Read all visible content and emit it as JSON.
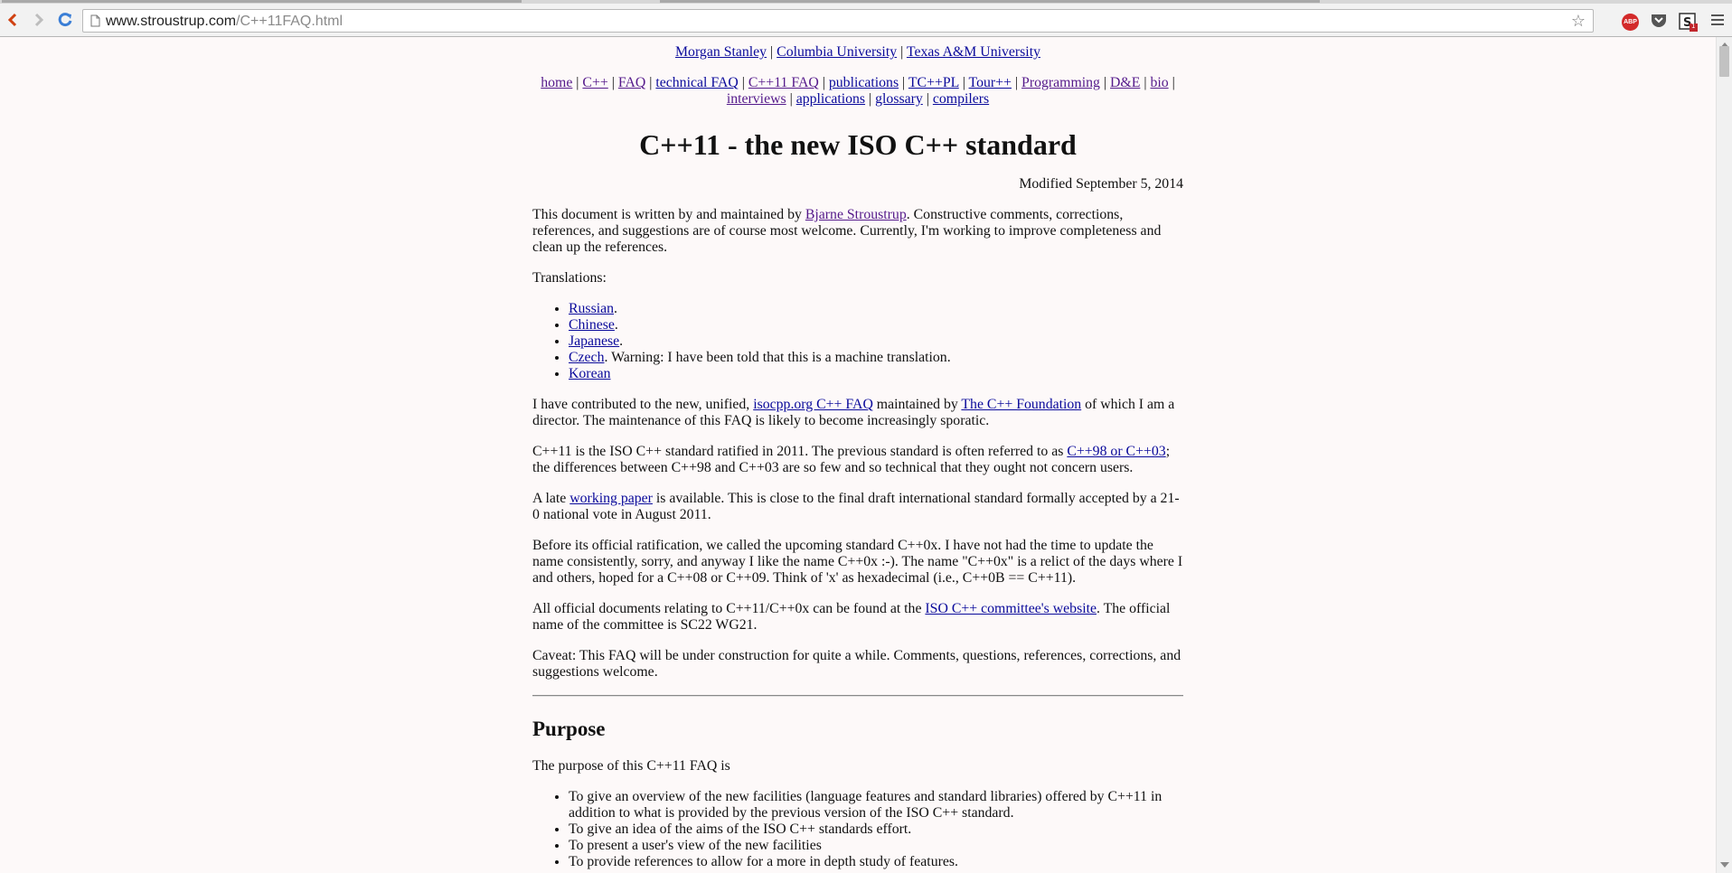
{
  "browser": {
    "url_host": "www.stroustrup.com",
    "url_path": "/C++11FAQ.html",
    "extensions": [
      "adblock-plus-icon",
      "pocket-icon",
      "s-extension-icon"
    ],
    "abp_label": "ABP",
    "ext_badge": "1"
  },
  "page": {
    "affiliations": [
      "Morgan Stanley",
      "Columbia University",
      "Texas A&M University"
    ],
    "nav_links": [
      {
        "label": "home"
      },
      {
        "label": "C++"
      },
      {
        "label": "FAQ"
      },
      {
        "label": "technical FAQ"
      },
      {
        "label": "C++11 FAQ"
      },
      {
        "label": "publications"
      },
      {
        "label": "TC++PL"
      },
      {
        "label": "Tour++"
      },
      {
        "label": "Programming"
      },
      {
        "label": "D&E"
      },
      {
        "label": "bio"
      },
      {
        "label": "interviews"
      },
      {
        "label": "applications"
      },
      {
        "label": "glossary"
      },
      {
        "label": "compilers"
      }
    ],
    "separator": "|",
    "title": "C++11 - the new ISO C++ standard",
    "modified": "Modified September 5, 2014",
    "intro": {
      "before": "This document is written by and maintained by ",
      "link": "Bjarne Stroustrup",
      "after": ". Constructive comments, corrections, references, and suggestions are of course most welcome. Currently, I'm working to improve completeness and clean up the references."
    },
    "translations_label": "Translations:",
    "translations": [
      {
        "link": "Russian",
        "suffix": "."
      },
      {
        "link": "Chinese",
        "suffix": "."
      },
      {
        "link": "Japanese",
        "suffix": "."
      },
      {
        "link": "Czech",
        "suffix": ". Warning: I have been told that this is a machine translation."
      },
      {
        "link": "Korean",
        "suffix": ""
      }
    ],
    "isocpp": {
      "before": "I have contributed to the new, unified, ",
      "link1": "isocpp.org C++ FAQ",
      "middle": " maintained by ",
      "link2": "The C++ Foundation",
      "after": " of which I am a director. The maintenance of this FAQ is likely to become increasingly sporatic."
    },
    "ratified": {
      "before": "C++11 is the ISO C++ standard ratified in 2011. The previous standard is often referred to as ",
      "link": "C++98 or C++03",
      "after": "; the differences between C++98 and C++03 are so few and so technical that they ought not concern users."
    },
    "working_paper": {
      "before": "A late ",
      "link": "working paper",
      "after": " is available. This is close to the final draft international standard formally accepted by a 21-0 national vote in August 2011."
    },
    "cpp0x": "Before its official ratification, we called the upcoming standard C++0x. I have not had the time to update the name consistently, sorry, and anyway I like the name C++0x :-). The name \"C++0x\" is a relict of the days where I and others, hoped for a C++08 or C++09. Think of 'x' as hexadecimal (i.e., C++0B == C++11).",
    "official_docs": {
      "before": "All official documents relating to C++11/C++0x can be found at the ",
      "link": "ISO C++ committee's website",
      "after": ". The official name of the committee is SC22 WG21."
    },
    "caveat": "Caveat: This FAQ will be under construction for quite a while. Comments, questions, references, corrections, and suggestions welcome.",
    "purpose_heading": "Purpose",
    "purpose_intro": "The purpose of this C++11 FAQ is",
    "purpose_items": [
      "To give an overview of the new facilities (language features and standard libraries) offered by C++11 in addition to what is provided by the previous version of the ISO C++ standard.",
      "To give an idea of the aims of the ISO C++ standards effort.",
      "To present a user's view of the new facilities",
      "To provide references to allow for a more in depth study of features."
    ]
  },
  "colors": {
    "link": "#0a0a9b",
    "visited_link": "#551a8b",
    "page_background": "#fdf9f9",
    "abp_red": "#d32a2a"
  }
}
